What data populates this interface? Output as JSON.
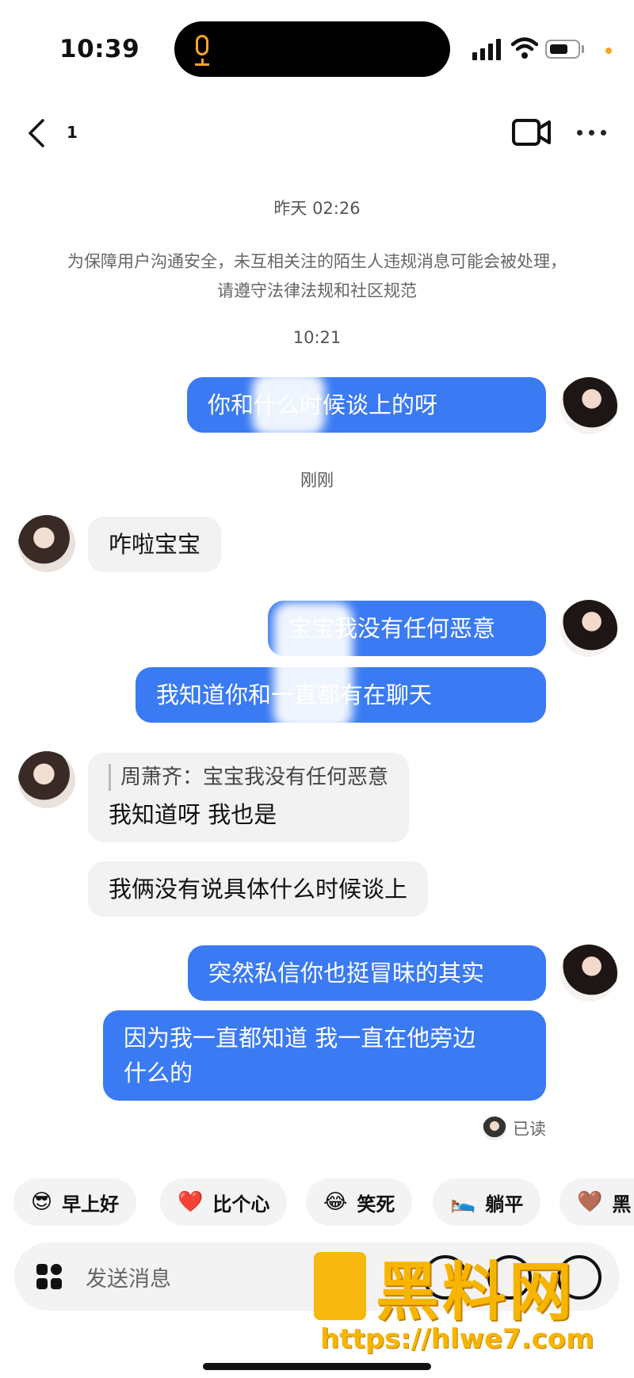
{
  "status_bar": {
    "time": "10:39"
  },
  "nav": {
    "unread_count": "1"
  },
  "chat": {
    "ts_yesterday": "昨天 02:26",
    "notice": "为保障用户沟通安全，未互相关注的陌生人违规消息可能会被处理，请遵守法律法规和社区规范",
    "ts_1021": "10:21",
    "ts_now": "刚刚",
    "messages": {
      "m1": "你和什么时候谈上的呀",
      "m2": "咋啦宝宝",
      "m3": "宝宝我没有任何恶意",
      "m4": "我知道你和一直都有在聊天",
      "m5_quote": "周萧齐：宝宝我没有任何恶意",
      "m5": "我知道呀 我也是",
      "m6": "我俩没有说具体什么时候谈上",
      "m7": "突然私信你也挺冒昧的其实",
      "m8_line1": "因为我一直都知道 我一直在他旁边",
      "m8_line2": "什么的"
    },
    "read_status": "已读"
  },
  "quick_replies": [
    {
      "emoji": "😎",
      "label": "早上好"
    },
    {
      "emoji": "❤️",
      "label": "比个心"
    },
    {
      "emoji": "😂",
      "label": "笑死"
    },
    {
      "emoji": "🛌",
      "label": "躺平"
    },
    {
      "emoji": "🤎",
      "label": "黑"
    }
  ],
  "input": {
    "placeholder": "发送消息"
  },
  "watermark": {
    "brand": "黑料网",
    "url": "https://hlwe7.com"
  }
}
